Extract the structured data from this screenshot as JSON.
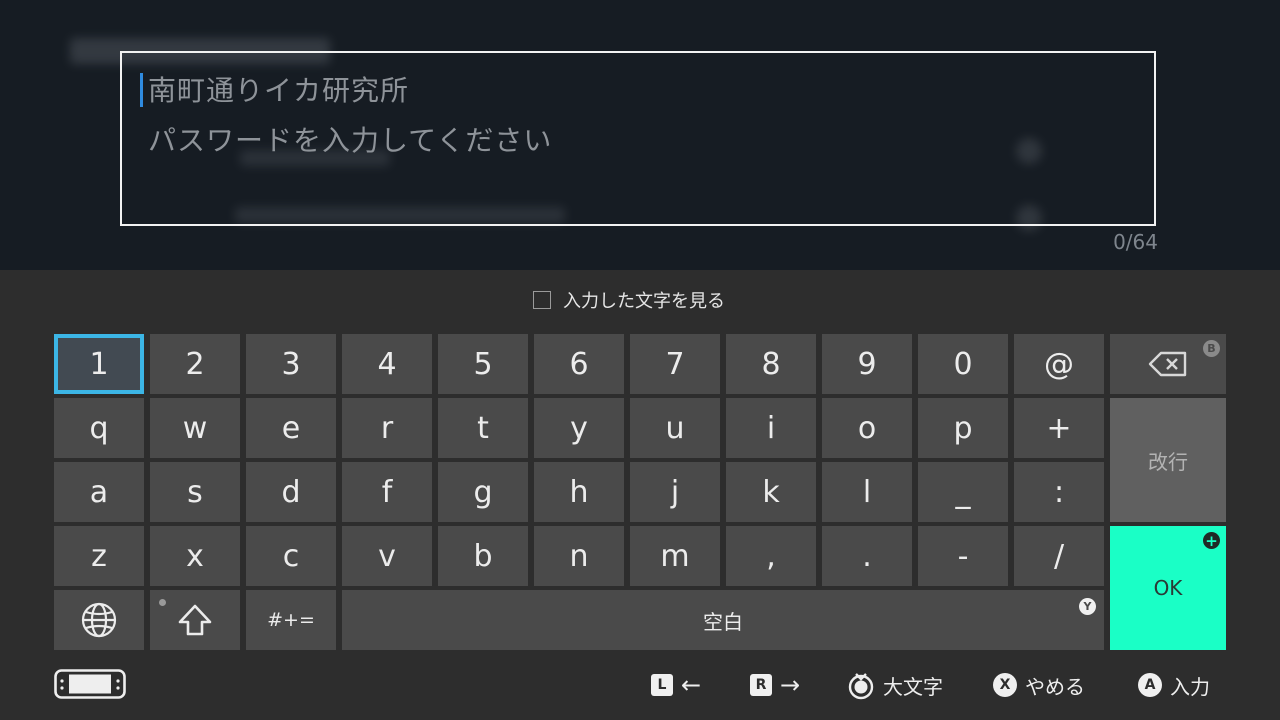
{
  "input": {
    "guide_title": "南町通りイカ研究所",
    "hint": "パスワードを入力してください",
    "char_count": "0/64"
  },
  "show_chars": {
    "label": "入力した文字を見る",
    "checked": false
  },
  "keyboard": {
    "rows": [
      [
        "1",
        "2",
        "3",
        "4",
        "5",
        "6",
        "7",
        "8",
        "9",
        "0",
        "@"
      ],
      [
        "q",
        "w",
        "e",
        "r",
        "t",
        "y",
        "u",
        "i",
        "o",
        "p",
        "+"
      ],
      [
        "a",
        "s",
        "d",
        "f",
        "g",
        "h",
        "j",
        "k",
        "l",
        "_",
        ":"
      ],
      [
        "z",
        "x",
        "c",
        "v",
        "b",
        "n",
        "m",
        ",",
        ".",
        "-",
        "/"
      ]
    ],
    "selected_key": "1",
    "symbols_label": "#+=",
    "space_label": "空白",
    "space_badge": "Y",
    "enter_label": "改行",
    "ok_label": "OK",
    "ok_badge": "+",
    "backspace_badge": "B",
    "globe_icon": "globe-icon",
    "shift_icon": "shift-icon",
    "backspace_icon": "backspace-icon",
    "accent_color": "#1affc6",
    "selection_color": "#3cb6e6"
  },
  "footer": {
    "l_button": "L",
    "l_arrow": "←",
    "r_button": "R",
    "r_arrow": "→",
    "stick_label": "大文字",
    "x_button": "X",
    "x_label": "やめる",
    "a_button": "A",
    "a_label": "入力",
    "console_icon": "console-icon"
  }
}
